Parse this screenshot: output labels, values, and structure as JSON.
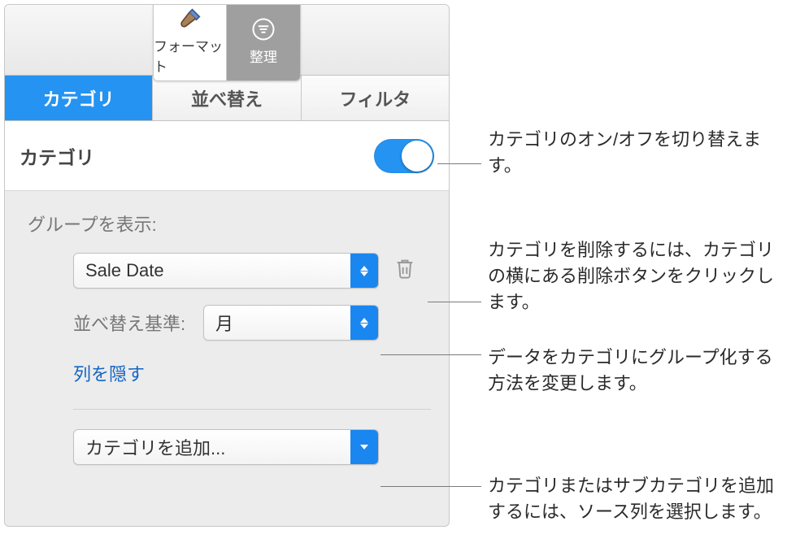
{
  "toolbar": {
    "format": {
      "label": "フォーマット"
    },
    "organize": {
      "label": "整理"
    }
  },
  "tabs": {
    "category": "カテゴリ",
    "sort": "並べ替え",
    "filter": "フィルタ"
  },
  "section": {
    "title": "カテゴリ",
    "groups_label": "グループを表示:",
    "source_column": "Sale Date",
    "sortby_label": "並べ替え基準:",
    "sortby_value": "月",
    "hide_column": "列を隠す",
    "add_category": "カテゴリを追加..."
  },
  "callouts": {
    "toggle": "カテゴリのオン/オフを切り替えます。",
    "delete": "カテゴリを削除するには、カテゴリの横にある削除ボタンをクリックします。",
    "group": "データをカテゴリにグループ化する方法を変更します。",
    "add": "カテゴリまたはサブカテゴリを追加するには、ソース列を選択します。"
  }
}
